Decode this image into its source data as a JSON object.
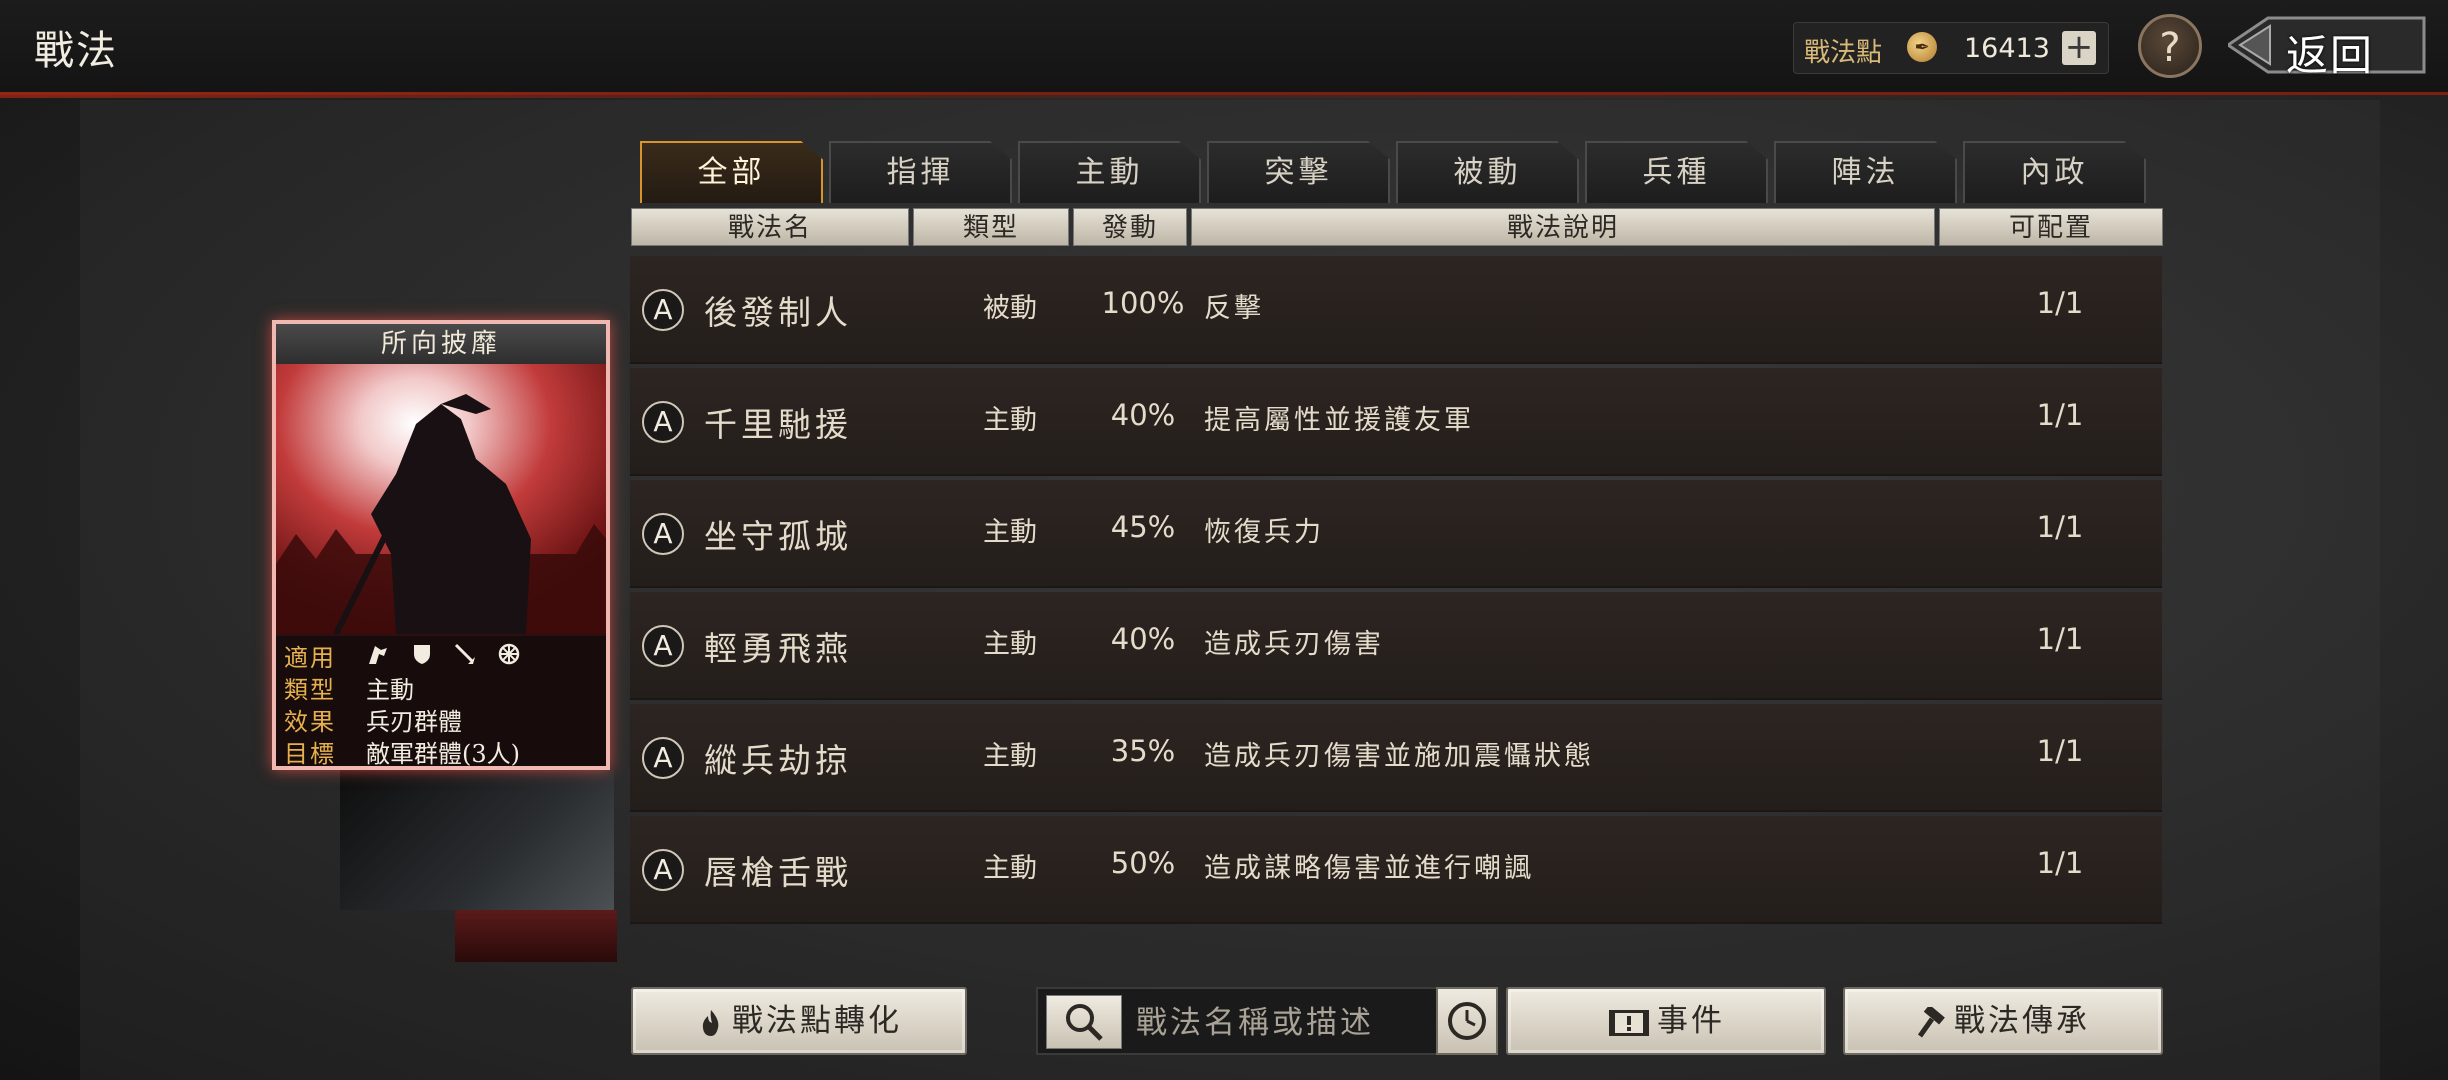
{
  "header": {
    "title": "戰法",
    "points_label": "戰法點",
    "points_value": "16413",
    "plus_label": "+",
    "help_label": "?",
    "back_label": "返回"
  },
  "tabs": [
    {
      "label": "全部",
      "active": true
    },
    {
      "label": "指揮",
      "active": false
    },
    {
      "label": "主動",
      "active": false
    },
    {
      "label": "突擊",
      "active": false
    },
    {
      "label": "被動",
      "active": false
    },
    {
      "label": "兵種",
      "active": false
    },
    {
      "label": "陣法",
      "active": false
    },
    {
      "label": "內政",
      "active": false
    }
  ],
  "columns": [
    "戰法名",
    "類型",
    "發動",
    "戰法說明",
    "可配置"
  ],
  "tactics": [
    {
      "grade": "A",
      "name": "後發制人",
      "type": "被動",
      "rate": "100%",
      "desc": "反擊",
      "config": "1/1"
    },
    {
      "grade": "A",
      "name": "千里馳援",
      "type": "主動",
      "rate": "40%",
      "desc": "提高屬性並援護友軍",
      "config": "1/1"
    },
    {
      "grade": "A",
      "name": "坐守孤城",
      "type": "主動",
      "rate": "45%",
      "desc": "恢復兵力",
      "config": "1/1"
    },
    {
      "grade": "A",
      "name": "輕勇飛燕",
      "type": "主動",
      "rate": "40%",
      "desc": "造成兵刃傷害",
      "config": "1/1"
    },
    {
      "grade": "A",
      "name": "縱兵劫掠",
      "type": "主動",
      "rate": "35%",
      "desc": "造成兵刃傷害並施加震懾狀態",
      "config": "1/1"
    },
    {
      "grade": "A",
      "name": "唇槍舌戰",
      "type": "主動",
      "rate": "50%",
      "desc": "造成謀略傷害並進行嘲諷",
      "config": "1/1"
    }
  ],
  "card": {
    "title": "所向披靡",
    "apply_key": "適用",
    "type_key": "類型",
    "type_value": "主動",
    "effect_key": "效果",
    "effect_value": "兵刃群體",
    "target_key": "目標",
    "target_value": "敵軍群體(3人)",
    "apply_icons": [
      "cavalry-icon",
      "shield-icon",
      "spear-icon",
      "siege-wheel-icon"
    ]
  },
  "bottom": {
    "convert_label": "戰法點轉化",
    "search_placeholder": "戰法名稱或描述",
    "event_label": "事件",
    "inherit_label": "戰法傳承"
  },
  "colors": {
    "accent_tab": "#d9932e",
    "card_glow": "#dc5046",
    "title_red": "#7a1f12"
  }
}
